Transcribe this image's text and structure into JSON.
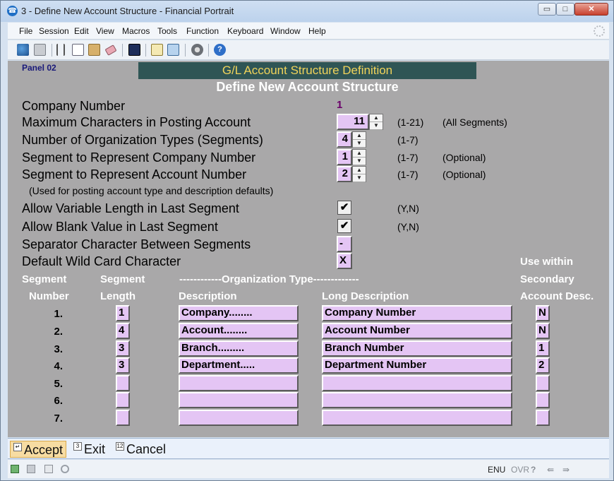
{
  "window": {
    "title": "3 - Define New Account Structure - Financial Portrait",
    "app_icon": "phone-icon",
    "controls": {
      "minimize": "▭",
      "maximize": "□",
      "close": "✕"
    }
  },
  "menu": [
    "File",
    "Session",
    "Edit",
    "View",
    "Macros",
    "Tools",
    "Function",
    "Keyboard",
    "Window",
    "Help"
  ],
  "toolbar_icons": [
    "connect-icon",
    "print-icon",
    "cut-icon",
    "copy-icon",
    "paste-icon",
    "eraser-icon",
    "display-icon",
    "form-icon",
    "screen-icon",
    "settings-icon",
    "help-icon"
  ],
  "panel": {
    "panel_id": "Panel 02",
    "banner": "G/L Account Structure Definition",
    "subtitle": "Define New Account Structure",
    "company_label": "Company Number",
    "company_value": "1",
    "max_chars": {
      "label": "Maximum Characters in Posting Account",
      "value": "11",
      "range": "(1-21)",
      "note": "(All Segments)"
    },
    "org_types": {
      "label": "Number of Organization Types (Segments)",
      "value": "4",
      "range": "(1-7)"
    },
    "seg_company": {
      "label": "Segment to Represent Company Number",
      "value": "1",
      "range": "(1-7)",
      "note": "(Optional)"
    },
    "seg_account": {
      "label": "Segment to Represent Account Number",
      "value": "2",
      "range": "(1-7)",
      "note": "(Optional)"
    },
    "usage_note": "(Used for posting account type and description defaults)",
    "variable_length": {
      "label": "Allow Variable Length in Last Segment",
      "value": "✔",
      "range": "(Y,N)"
    },
    "blank_value": {
      "label": "Allow Blank Value in Last Segment",
      "value": "✔",
      "range": "(Y,N)"
    },
    "separator": {
      "label": "Separator Character Between Segments",
      "value": "-"
    },
    "wildcard": {
      "label": "Default Wild Card Character",
      "value": "X"
    },
    "headers": {
      "segment1": "Segment",
      "number": "Number",
      "segment2": "Segment",
      "length": "Length",
      "org_type": "------------Organization Type-------------",
      "description": "Description",
      "long_description": "Long Description",
      "use_within": "Use within",
      "secondary": "Secondary",
      "account_desc": "Account Desc."
    },
    "rows": [
      {
        "num": "1.",
        "length": "1",
        "desc": "Company........",
        "long": "Company Number",
        "use": "N"
      },
      {
        "num": "2.",
        "length": "4",
        "desc": "Account........",
        "long": "Account Number",
        "use": "N"
      },
      {
        "num": "3.",
        "length": "3",
        "desc": "Branch.........",
        "long": "Branch Number",
        "use": "1"
      },
      {
        "num": "4.",
        "length": "3",
        "desc": "Department.....",
        "long": "Department Number",
        "use": "2"
      },
      {
        "num": "5.",
        "length": "",
        "desc": "",
        "long": "",
        "use": ""
      },
      {
        "num": "6.",
        "length": "",
        "desc": "",
        "long": "",
        "use": ""
      },
      {
        "num": "7.",
        "length": "",
        "desc": "",
        "long": "",
        "use": ""
      }
    ]
  },
  "fkeys": [
    {
      "key": "↵",
      "label": "Accept"
    },
    {
      "key": "3",
      "label": "Exit"
    },
    {
      "key": "12",
      "label": "Cancel"
    }
  ],
  "status": {
    "lang": "ENU",
    "ovr": "OVR",
    "q": "?"
  },
  "colors": {
    "panel_bg": "#a9a8a9",
    "field_bg": "#e4c5f4",
    "banner_bg": "#2f5555",
    "banner_text": "#f0d35a"
  }
}
